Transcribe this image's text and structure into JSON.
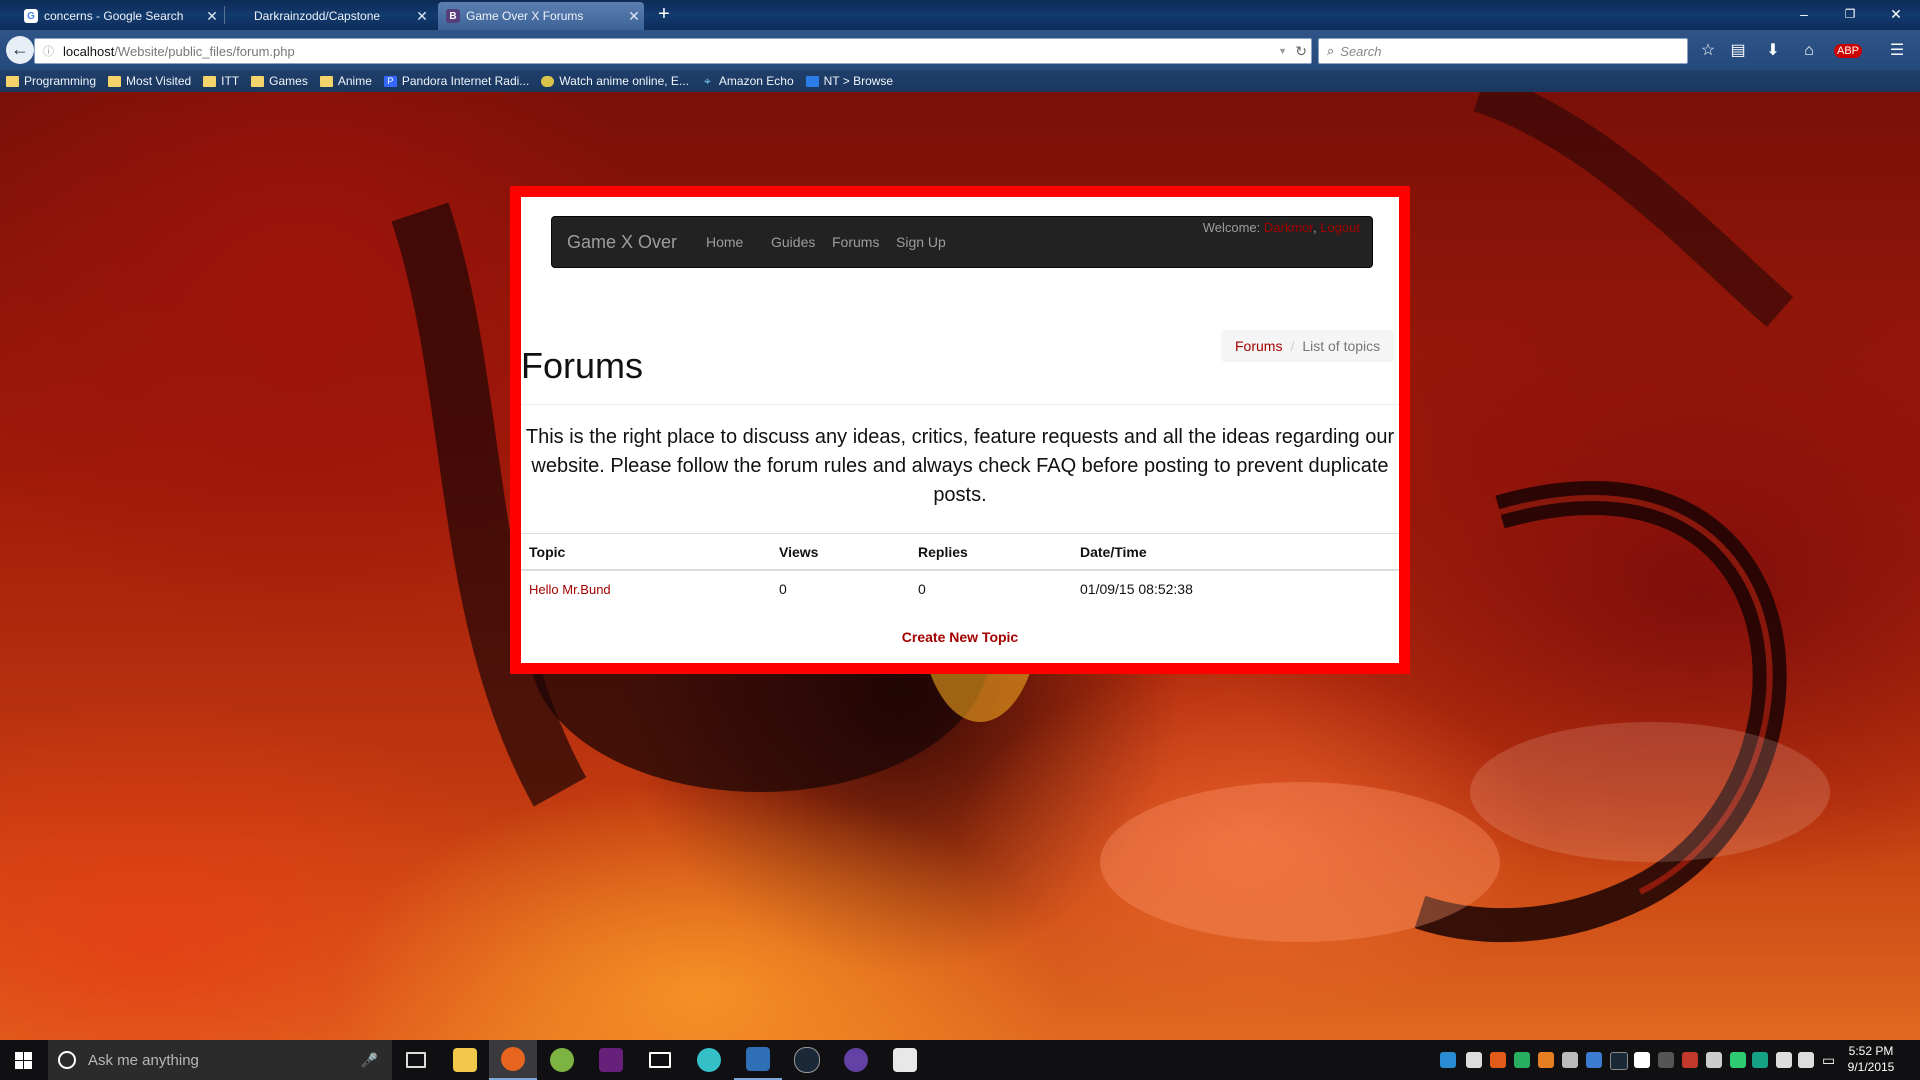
{
  "browser": {
    "tabs": [
      {
        "label": "concerns - Google Search",
        "icon": "google-icon",
        "active": false
      },
      {
        "label": "Darkrainzodd/Capstone",
        "icon": "blank-icon",
        "active": false
      },
      {
        "label": "Game Over X Forums",
        "icon": "bootstrap-icon",
        "active": true
      }
    ],
    "new_tab": "+",
    "window": {
      "minimize": "–",
      "maximize": "❐",
      "close": "✕"
    },
    "url": {
      "host": "localhost",
      "path": "/Website/public_files/forum.php"
    },
    "search_placeholder": "Search",
    "bookmarks": [
      {
        "label": "Programming",
        "icon": "folder-icon"
      },
      {
        "label": "Most Visited",
        "icon": "folder-icon"
      },
      {
        "label": "ITT",
        "icon": "folder-icon"
      },
      {
        "label": "Games",
        "icon": "folder-icon"
      },
      {
        "label": "Anime",
        "icon": "folder-icon"
      },
      {
        "label": "Pandora Internet Radi...",
        "icon": "pandora-icon"
      },
      {
        "label": "Watch anime online, E...",
        "icon": "anime-site-icon"
      },
      {
        "label": "Amazon Echo",
        "icon": "location-pin-icon"
      },
      {
        "label": "NT > Browse",
        "icon": "nt-icon"
      }
    ]
  },
  "site": {
    "brand": "Game X Over",
    "nav": [
      "Home",
      "Guides",
      "Forums",
      "Sign Up"
    ],
    "welcome": {
      "prefix": "Welcome: ",
      "user": "Darkmor",
      "separator": ", ",
      "logout": "Logout"
    },
    "breadcrumb": {
      "link": "Forums",
      "separator": "/",
      "current": "List of topics"
    },
    "title": "Forums",
    "intro": "This is the right place to discuss any ideas, critics, feature requests and all the ideas regarding our website. Please follow the forum rules and always check FAQ before posting to prevent duplicate posts.",
    "table": {
      "headers": [
        "Topic",
        "Views",
        "Replies",
        "Date/Time"
      ],
      "rows": [
        {
          "topic": "Hello Mr.Bund",
          "views": "0",
          "replies": "0",
          "datetime": "01/09/15 08:52:38"
        }
      ]
    },
    "create_topic": "Create New Topic"
  },
  "taskbar": {
    "search_placeholder": "Ask me anything",
    "clock": {
      "time": "5:52 PM",
      "date": "9/1/2015"
    }
  },
  "colors": {
    "panel_border": "#ff0000",
    "link_red": "#a30000",
    "navbar_bg": "#222222",
    "nav_text": "#9d9d9d"
  }
}
